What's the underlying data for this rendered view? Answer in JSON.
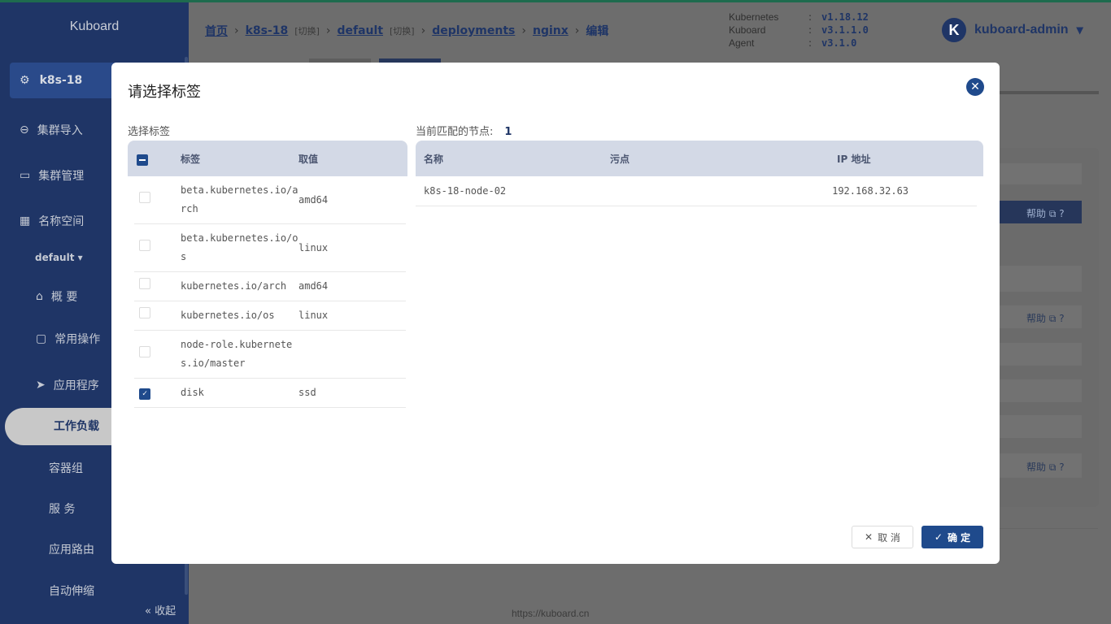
{
  "sidebar": {
    "logo": "Kuboard",
    "cluster": "k8s-18",
    "items": [
      {
        "label": "集群导入"
      },
      {
        "label": "集群管理"
      },
      {
        "label": "名称空间"
      }
    ],
    "namespace": "default",
    "ns_items": [
      {
        "label": "概 要"
      },
      {
        "label": "常用操作"
      },
      {
        "label": "应用程序"
      }
    ],
    "active": "工作负载",
    "sub_items": [
      {
        "label": "容器组"
      },
      {
        "label": "服 务"
      },
      {
        "label": "应用路由"
      },
      {
        "label": "自动伸缩"
      }
    ],
    "collapse": "« 收起"
  },
  "breadcrumb": {
    "home": "首页",
    "cluster": "k8s-18",
    "switch": "[切换]",
    "namespace": "default",
    "kind": "deployments",
    "name": "nginx",
    "action": "编辑"
  },
  "versions": [
    {
      "name": "Kubernetes",
      "value": "v1.18.12"
    },
    {
      "name": "Kuboard",
      "value": "v3.1.1.0"
    },
    {
      "name": "Agent",
      "value": "v3.1.0"
    }
  ],
  "user": {
    "avatar_letter": "K",
    "name": "kuboard-admin"
  },
  "help_label": "帮助",
  "footer": "https://kuboard.cn",
  "modal": {
    "title": "请选择标签",
    "left_label": "选择标签",
    "right_label": "当前匹配的节点:",
    "match_count": "1",
    "label_table": {
      "headers": {
        "label": "标签",
        "value": "取值"
      },
      "rows": [
        {
          "label": "beta.kubernetes.io/arch",
          "value": "amd64",
          "checked": false
        },
        {
          "label": "beta.kubernetes.io/os",
          "value": "linux",
          "checked": false
        },
        {
          "label": "kubernetes.io/arch",
          "value": "amd64",
          "checked": false
        },
        {
          "label": "kubernetes.io/os",
          "value": "linux",
          "checked": false
        },
        {
          "label": "node-role.kubernetes.io/master",
          "value": "",
          "checked": false
        },
        {
          "label": "disk",
          "value": "ssd",
          "checked": true
        }
      ]
    },
    "node_table": {
      "headers": {
        "name": "名称",
        "taint": "污点",
        "ip": "IP 地址"
      },
      "rows": [
        {
          "name": "k8s-18-node-02",
          "taint": "",
          "ip": "192.168.32.63"
        }
      ]
    },
    "cancel": "取 消",
    "ok": "确 定"
  },
  "colors": {
    "primary": "#1f4a8c",
    "sidebar": "#1f3566"
  }
}
